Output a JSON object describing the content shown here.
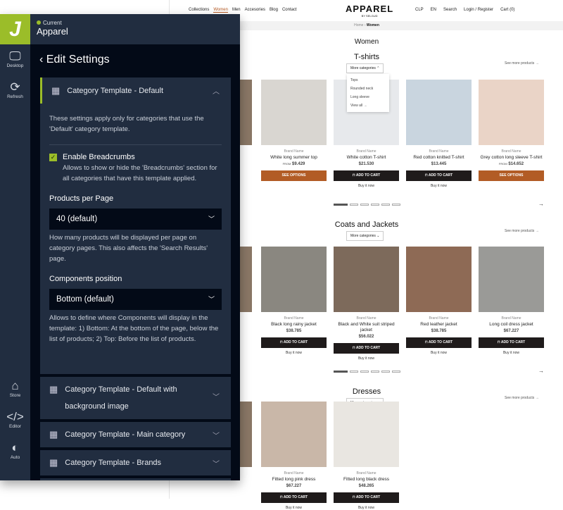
{
  "store": {
    "nav": [
      "Collections",
      "Women",
      "Men",
      "Accesories",
      "Blog",
      "Contact"
    ],
    "logo": "APPAREL",
    "logo_sub": "BY SELGUD",
    "util": [
      "CLP",
      "EN",
      "Search",
      "Login / Register",
      "Cart (0)"
    ],
    "breadcrumb": {
      "home": "Home",
      "current": "Women"
    },
    "page_title": "Women",
    "more_categories": "More categories",
    "see_more": "See more products →",
    "dropdown": [
      "Tops",
      "Rounded neck",
      "Long sleeve",
      "View all →"
    ],
    "brand": "Brand Name",
    "add_to_cart": "ADD TO CART",
    "see_options": "SEE OPTIONS",
    "buy_now": "Buy it now",
    "from": "FROM",
    "sections": [
      {
        "title": "T-shirts",
        "products": [
          {
            "name": "White long summer top",
            "price": "$9.429",
            "from": true,
            "btn": "options",
            "color": "#d9d6d1"
          },
          {
            "name": "White cotton T-shirt",
            "price": "$21.530",
            "btn": "cart",
            "color": "#e7e9ec"
          },
          {
            "name": "Red cotton knitted T-shirt",
            "price": "$13.445",
            "btn": "cart",
            "color": "#c9d5df"
          },
          {
            "name": "Grey cotton long sleeve T-shirt",
            "price": "$14.652",
            "from": true,
            "btn": "options",
            "color": "#ead4c7"
          }
        ]
      },
      {
        "title": "Coats and Jackets",
        "products": [
          {
            "name": "Black long rainy jacket",
            "price": "$38.785",
            "btn": "cart",
            "color": "#8a8780"
          },
          {
            "name": "Black and White suit striped jacket",
            "price": "$56.022",
            "btn": "cart",
            "color": "#7d6a5b"
          },
          {
            "name": "Red leather jacket",
            "price": "$38.785",
            "btn": "cart",
            "color": "#8e6a55"
          },
          {
            "name": "Long coil dress jacket",
            "price": "$67.227",
            "btn": "cart",
            "color": "#9a9a97"
          }
        ]
      },
      {
        "title": "Dresses",
        "products": [
          {
            "name": "Fitted long pink dress",
            "price": "$67.227",
            "btn": "cart",
            "color": "#c9b7a8"
          },
          {
            "name": "Fitted long black dress",
            "price": "$48.265",
            "btn": "cart",
            "color": "#e9e6e1"
          }
        ]
      }
    ]
  },
  "panel": {
    "current": "Current",
    "store_name": "Apparel",
    "sidebar": [
      {
        "label": "Desktop",
        "icon": "desktop-icon"
      },
      {
        "label": "Refresh",
        "icon": "refresh-icon"
      },
      {
        "label": "Store",
        "icon": "store-icon"
      },
      {
        "label": "Editor",
        "icon": "code-icon"
      },
      {
        "label": "Auto",
        "icon": "theme-auto-icon"
      }
    ],
    "title": "Edit Settings",
    "open_section": "Category Template - Default",
    "intro": "These settings apply only for categories that use the 'Default' category template.",
    "breadcrumbs_label": "Enable Breadcrumbs",
    "breadcrumbs_checked": true,
    "breadcrumbs_help": "Allows to show or hide the 'Breadcrumbs' section for all categories that have this template applied.",
    "ppp_label": "Products per Page",
    "ppp_value": "40 (default)",
    "ppp_help": "How many products will be displayed per page on category pages. This also affects the 'Search Results' page.",
    "comp_label": "Components position",
    "comp_value": "Bottom (default)",
    "comp_help": "Allows to define where Components will display in the template: 1) Bottom: At the bottom of the page, below the list of products; 2) Top: Before the list of products.",
    "sections": [
      "Category Template - Default with background image",
      "Category Template - Main category",
      "Category Template - Brands"
    ]
  }
}
